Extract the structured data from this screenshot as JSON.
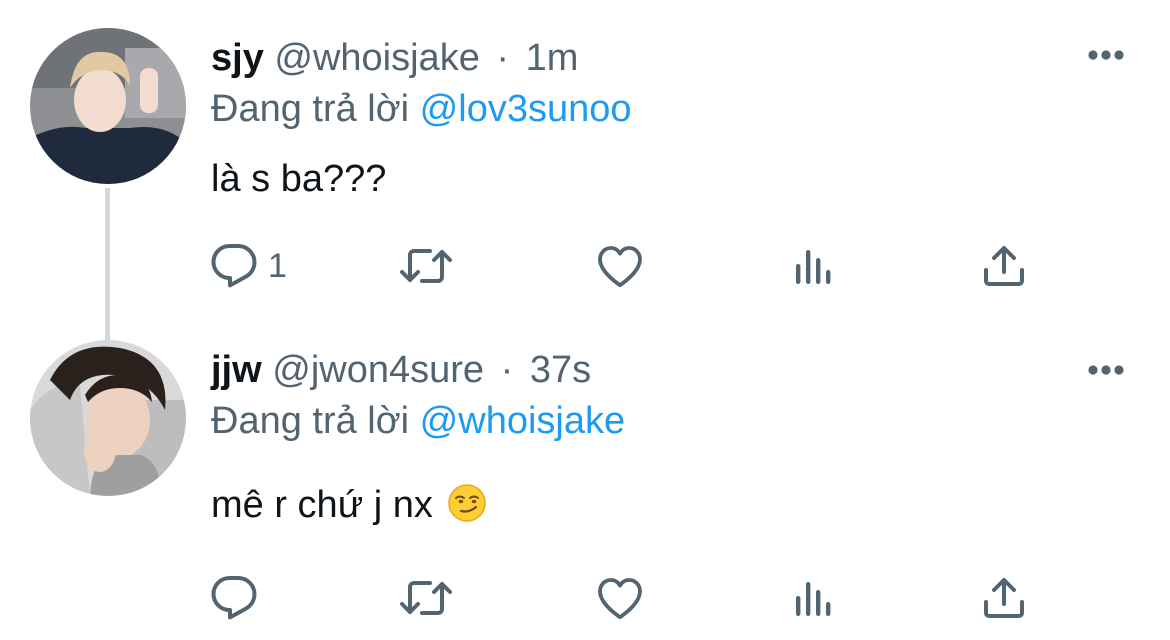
{
  "tweets": [
    {
      "display_name": "sjy",
      "handle": "@whoisjake",
      "separator": "·",
      "time": "1m",
      "reply_prefix": "Đang trả lời",
      "reply_to": "@lov3sunoo",
      "text": "là s ba???",
      "reply_count": "1",
      "avatar_icon": "avatar-photo"
    },
    {
      "display_name": "jjw",
      "handle": "@jwon4sure",
      "separator": "·",
      "time": "37s",
      "reply_prefix": "Đang trả lời",
      "reply_to": "@whoisjake",
      "text": "mê r chứ j nx",
      "emoji": "smirking-face-emoji",
      "reply_count": "",
      "avatar_icon": "avatar-photo"
    }
  ],
  "colors": {
    "text_primary": "#0f1419",
    "text_secondary": "#536471",
    "link": "#1d9bf0",
    "thread_line": "#cfd9de"
  },
  "icons": {
    "more": "more-horizontal-icon",
    "reply": "reply-bubble-icon",
    "retweet": "retweet-icon",
    "like": "heart-icon",
    "stats": "bar-chart-icon",
    "share": "share-upload-icon"
  }
}
